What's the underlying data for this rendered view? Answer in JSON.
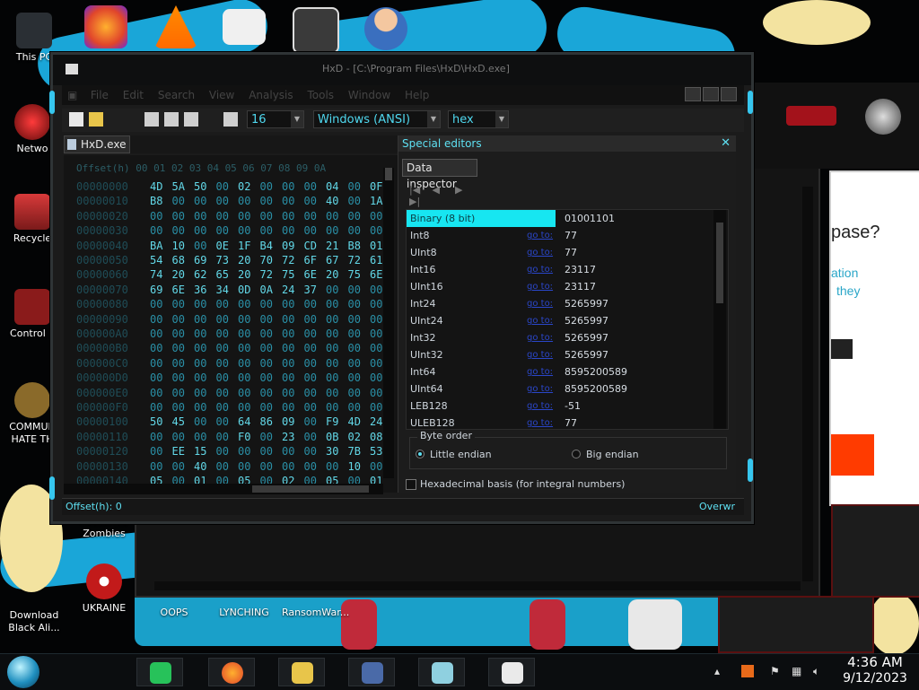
{
  "desktop": {
    "icons_left": [
      {
        "label": "This PC"
      },
      {
        "label": "Netwo"
      },
      {
        "label": "Recycle"
      },
      {
        "label": "Control P"
      },
      {
        "label": "COMMUN HATE TH"
      },
      {
        "label": "Plants vs. Zombies"
      }
    ],
    "icons_bottom": [
      {
        "label": "Download Black Ali..."
      },
      {
        "label": "UKRAINE"
      },
      {
        "label": "OOPS"
      },
      {
        "label": "LYNCHING"
      },
      {
        "label": "RansomWar..."
      }
    ],
    "bg_text": {
      "question": "pase?",
      "line1": "ation",
      "line2": "they"
    }
  },
  "hxd": {
    "title": "HxD - [C:\\Program Files\\HxD\\HxD.exe]",
    "menu": [
      "File",
      "Edit",
      "Search",
      "View",
      "Analysis",
      "Tools",
      "Window",
      "Help"
    ],
    "toolbar": {
      "bytes_per_row": "16",
      "charset": "Windows (ANSI)",
      "offset_base": "hex"
    },
    "tab": "HxD.exe",
    "hex_header": "Offset(h)  00 01 02 03 04 05 06 07 08 09 0A",
    "hex_rows": [
      {
        "offset": "00000000",
        "bytes": [
          "4D",
          "5A",
          "50",
          "00",
          "02",
          "00",
          "00",
          "00",
          "04",
          "00",
          "0F"
        ]
      },
      {
        "offset": "00000010",
        "bytes": [
          "B8",
          "00",
          "00",
          "00",
          "00",
          "00",
          "00",
          "00",
          "40",
          "00",
          "1A"
        ]
      },
      {
        "offset": "00000020",
        "bytes": [
          "00",
          "00",
          "00",
          "00",
          "00",
          "00",
          "00",
          "00",
          "00",
          "00",
          "00"
        ]
      },
      {
        "offset": "00000030",
        "bytes": [
          "00",
          "00",
          "00",
          "00",
          "00",
          "00",
          "00",
          "00",
          "00",
          "00",
          "00"
        ]
      },
      {
        "offset": "00000040",
        "bytes": [
          "BA",
          "10",
          "00",
          "0E",
          "1F",
          "B4",
          "09",
          "CD",
          "21",
          "B8",
          "01"
        ]
      },
      {
        "offset": "00000050",
        "bytes": [
          "54",
          "68",
          "69",
          "73",
          "20",
          "70",
          "72",
          "6F",
          "67",
          "72",
          "61"
        ]
      },
      {
        "offset": "00000060",
        "bytes": [
          "74",
          "20",
          "62",
          "65",
          "20",
          "72",
          "75",
          "6E",
          "20",
          "75",
          "6E"
        ]
      },
      {
        "offset": "00000070",
        "bytes": [
          "69",
          "6E",
          "36",
          "34",
          "0D",
          "0A",
          "24",
          "37",
          "00",
          "00",
          "00"
        ]
      },
      {
        "offset": "00000080",
        "bytes": [
          "00",
          "00",
          "00",
          "00",
          "00",
          "00",
          "00",
          "00",
          "00",
          "00",
          "00"
        ]
      },
      {
        "offset": "00000090",
        "bytes": [
          "00",
          "00",
          "00",
          "00",
          "00",
          "00",
          "00",
          "00",
          "00",
          "00",
          "00"
        ]
      },
      {
        "offset": "000000A0",
        "bytes": [
          "00",
          "00",
          "00",
          "00",
          "00",
          "00",
          "00",
          "00",
          "00",
          "00",
          "00"
        ]
      },
      {
        "offset": "000000B0",
        "bytes": [
          "00",
          "00",
          "00",
          "00",
          "00",
          "00",
          "00",
          "00",
          "00",
          "00",
          "00"
        ]
      },
      {
        "offset": "000000C0",
        "bytes": [
          "00",
          "00",
          "00",
          "00",
          "00",
          "00",
          "00",
          "00",
          "00",
          "00",
          "00"
        ]
      },
      {
        "offset": "000000D0",
        "bytes": [
          "00",
          "00",
          "00",
          "00",
          "00",
          "00",
          "00",
          "00",
          "00",
          "00",
          "00"
        ]
      },
      {
        "offset": "000000E0",
        "bytes": [
          "00",
          "00",
          "00",
          "00",
          "00",
          "00",
          "00",
          "00",
          "00",
          "00",
          "00"
        ]
      },
      {
        "offset": "000000F0",
        "bytes": [
          "00",
          "00",
          "00",
          "00",
          "00",
          "00",
          "00",
          "00",
          "00",
          "00",
          "00"
        ]
      },
      {
        "offset": "00000100",
        "bytes": [
          "50",
          "45",
          "00",
          "00",
          "64",
          "86",
          "09",
          "00",
          "F9",
          "4D",
          "24"
        ]
      },
      {
        "offset": "00000110",
        "bytes": [
          "00",
          "00",
          "00",
          "00",
          "F0",
          "00",
          "23",
          "00",
          "0B",
          "02",
          "08"
        ]
      },
      {
        "offset": "00000120",
        "bytes": [
          "00",
          "EE",
          "15",
          "00",
          "00",
          "00",
          "00",
          "00",
          "30",
          "7B",
          "53"
        ]
      },
      {
        "offset": "00000130",
        "bytes": [
          "00",
          "00",
          "40",
          "00",
          "00",
          "00",
          "00",
          "00",
          "00",
          "10",
          "00"
        ]
      },
      {
        "offset": "00000140",
        "bytes": [
          "05",
          "00",
          "01",
          "00",
          "05",
          "00",
          "02",
          "00",
          "05",
          "00",
          "01"
        ]
      }
    ],
    "special_editors": {
      "title": "Special editors",
      "tab": "Data inspector",
      "nav": [
        "|◀",
        "◀",
        "▶",
        "▶|"
      ],
      "rows": [
        {
          "name": "Binary (8 bit)",
          "link": "",
          "value": "01001101"
        },
        {
          "name": "Int8",
          "link": "go to:",
          "value": "77"
        },
        {
          "name": "UInt8",
          "link": "go to:",
          "value": "77"
        },
        {
          "name": "Int16",
          "link": "go to:",
          "value": "23117"
        },
        {
          "name": "UInt16",
          "link": "go to:",
          "value": "23117"
        },
        {
          "name": "Int24",
          "link": "go to:",
          "value": "5265997"
        },
        {
          "name": "UInt24",
          "link": "go to:",
          "value": "5265997"
        },
        {
          "name": "Int32",
          "link": "go to:",
          "value": "5265997"
        },
        {
          "name": "UInt32",
          "link": "go to:",
          "value": "5265997"
        },
        {
          "name": "Int64",
          "link": "go to:",
          "value": "8595200589"
        },
        {
          "name": "UInt64",
          "link": "go to:",
          "value": "8595200589"
        },
        {
          "name": "LEB128",
          "link": "go to:",
          "value": "-51"
        },
        {
          "name": "ULEB128",
          "link": "go to:",
          "value": "77"
        }
      ],
      "byte_order_label": "Byte order",
      "little_endian": "Little endian",
      "big_endian": "Big endian",
      "hex_basis": "Hexadecimal basis (for integral numbers)"
    },
    "status_left": "Offset(h): 0",
    "status_right": "Overwr"
  },
  "taskbar": {
    "time": "4:36 AM",
    "date": "9/12/2023"
  },
  "colors": {
    "accent": "#5ee0f2",
    "selection": "#17e6f1",
    "hex": "#62d8e8"
  }
}
